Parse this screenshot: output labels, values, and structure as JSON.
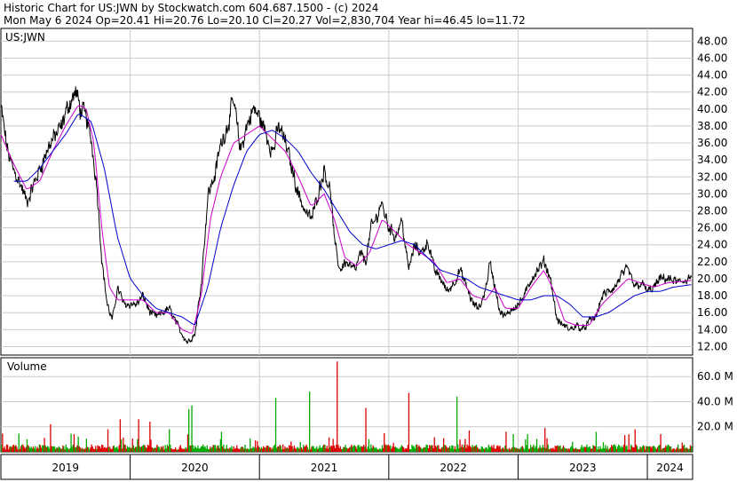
{
  "header": {
    "line1": "Historic Chart for US:JWN by Stockwatch.com 604.687.1500 - (c) 2024",
    "line2": "Mon May  6 2024  Op=20.41  Hi=20.76  Lo=20.10  Cl=20.27  Vol=2,830,704  Year hi=46.45  lo=11.72"
  },
  "chart_data": [
    {
      "type": "line",
      "label": "US:JWN",
      "ylim": [
        11,
        49.5
      ],
      "y_ticks": [
        "48.00",
        "46.00",
        "44.00",
        "42.00",
        "40.00",
        "38.00",
        "36.00",
        "34.00",
        "32.00",
        "30.00",
        "28.00",
        "26.00",
        "24.00",
        "22.00",
        "20.00",
        "18.00",
        "16.00",
        "14.00",
        "12.00"
      ],
      "x_ticks": [
        "2019",
        "2020",
        "2021",
        "2022",
        "2023",
        "2024"
      ],
      "price_anchors": [
        [
          2019.0,
          40.0
        ],
        [
          2019.05,
          35.0
        ],
        [
          2019.09,
          33.0
        ],
        [
          2019.14,
          31.5
        ],
        [
          2019.2,
          29.0
        ],
        [
          2019.25,
          31.0
        ],
        [
          2019.3,
          33.0
        ],
        [
          2019.38,
          36.0
        ],
        [
          2019.47,
          38.0
        ],
        [
          2019.52,
          40.5
        ],
        [
          2019.58,
          42.0
        ],
        [
          2019.61,
          40.0
        ],
        [
          2019.66,
          39.0
        ],
        [
          2019.7,
          36.0
        ],
        [
          2019.74,
          31.0
        ],
        [
          2019.78,
          22.0
        ],
        [
          2019.82,
          17.0
        ],
        [
          2019.86,
          15.0
        ],
        [
          2019.9,
          19.0
        ],
        [
          2019.95,
          17.0
        ],
        [
          2020.05,
          17.0
        ],
        [
          2020.1,
          18.0
        ],
        [
          2020.15,
          16.0
        ],
        [
          2020.2,
          15.5
        ],
        [
          2020.3,
          16.5
        ],
        [
          2020.38,
          14.0
        ],
        [
          2020.44,
          12.5
        ],
        [
          2020.5,
          13.5
        ],
        [
          2020.55,
          20.0
        ],
        [
          2020.6,
          30.0
        ],
        [
          2020.65,
          32.0
        ],
        [
          2020.7,
          36.0
        ],
        [
          2020.75,
          38.0
        ],
        [
          2020.8,
          41.0
        ],
        [
          2020.85,
          35.0
        ],
        [
          2020.9,
          38.0
        ],
        [
          2020.95,
          40.0
        ],
        [
          2021.0,
          39.0
        ],
        [
          2021.05,
          37.0
        ],
        [
          2021.1,
          35.0
        ],
        [
          2021.15,
          38.0
        ],
        [
          2021.2,
          36.0
        ],
        [
          2021.25,
          33.0
        ],
        [
          2021.3,
          30.0
        ],
        [
          2021.35,
          28.0
        ],
        [
          2021.4,
          27.0
        ],
        [
          2021.45,
          30.0
        ],
        [
          2021.5,
          33.0
        ],
        [
          2021.55,
          30.0
        ],
        [
          2021.58,
          24.0
        ],
        [
          2021.62,
          21.0
        ],
        [
          2021.66,
          22.0
        ],
        [
          2021.7,
          21.5
        ],
        [
          2021.74,
          21.0
        ],
        [
          2021.78,
          23.0
        ],
        [
          2021.82,
          22.0
        ],
        [
          2021.86,
          26.0
        ],
        [
          2021.9,
          27.0
        ],
        [
          2021.94,
          29.0
        ],
        [
          2022.0,
          26.0
        ],
        [
          2022.05,
          25.0
        ],
        [
          2022.1,
          27.0
        ],
        [
          2022.15,
          21.0
        ],
        [
          2022.2,
          24.0
        ],
        [
          2022.25,
          23.0
        ],
        [
          2022.3,
          24.5
        ],
        [
          2022.35,
          21.0
        ],
        [
          2022.4,
          20.0
        ],
        [
          2022.45,
          18.5
        ],
        [
          2022.5,
          19.5
        ],
        [
          2022.55,
          21.0
        ],
        [
          2022.6,
          19.0
        ],
        [
          2022.65,
          17.0
        ],
        [
          2022.7,
          16.5
        ],
        [
          2022.75,
          19.0
        ],
        [
          2022.78,
          22.0
        ],
        [
          2022.82,
          19.0
        ],
        [
          2022.86,
          16.0
        ],
        [
          2022.9,
          15.5
        ],
        [
          2022.95,
          16.5
        ],
        [
          2023.0,
          17.0
        ],
        [
          2023.05,
          18.0
        ],
        [
          2023.1,
          20.0
        ],
        [
          2023.15,
          21.0
        ],
        [
          2023.2,
          22.0
        ],
        [
          2023.25,
          20.0
        ],
        [
          2023.3,
          15.0
        ],
        [
          2023.35,
          14.5
        ],
        [
          2023.4,
          14.0
        ],
        [
          2023.45,
          14.5
        ],
        [
          2023.5,
          14.0
        ],
        [
          2023.55,
          15.0
        ],
        [
          2023.6,
          15.5
        ],
        [
          2023.65,
          18.0
        ],
        [
          2023.7,
          18.5
        ],
        [
          2023.75,
          19.0
        ],
        [
          2023.8,
          20.5
        ],
        [
          2023.85,
          21.0
        ],
        [
          2023.9,
          19.0
        ],
        [
          2023.95,
          19.5
        ],
        [
          2024.0,
          18.5
        ],
        [
          2024.05,
          19.0
        ],
        [
          2024.1,
          20.0
        ],
        [
          2024.15,
          20.0
        ],
        [
          2024.25,
          19.5
        ],
        [
          2024.34,
          20.3
        ]
      ],
      "ma_fast_anchors": [
        [
          2019.0,
          37.0
        ],
        [
          2019.1,
          33.5
        ],
        [
          2019.2,
          30.5
        ],
        [
          2019.3,
          31.5
        ],
        [
          2019.4,
          35.0
        ],
        [
          2019.5,
          38.0
        ],
        [
          2019.6,
          40.5
        ],
        [
          2019.66,
          40.0
        ],
        [
          2019.72,
          36.0
        ],
        [
          2019.78,
          26.0
        ],
        [
          2019.84,
          19.0
        ],
        [
          2019.9,
          17.5
        ],
        [
          2020.0,
          17.5
        ],
        [
          2020.1,
          17.5
        ],
        [
          2020.2,
          16.0
        ],
        [
          2020.3,
          16.0
        ],
        [
          2020.4,
          14.0
        ],
        [
          2020.48,
          13.5
        ],
        [
          2020.55,
          18.0
        ],
        [
          2020.62,
          27.0
        ],
        [
          2020.7,
          32.0
        ],
        [
          2020.8,
          36.0
        ],
        [
          2020.9,
          37.0
        ],
        [
          2021.0,
          38.0
        ],
        [
          2021.1,
          36.5
        ],
        [
          2021.2,
          35.0
        ],
        [
          2021.3,
          32.0
        ],
        [
          2021.4,
          28.5
        ],
        [
          2021.5,
          30.0
        ],
        [
          2021.58,
          27.0
        ],
        [
          2021.66,
          22.5
        ],
        [
          2021.75,
          21.5
        ],
        [
          2021.85,
          23.0
        ],
        [
          2021.95,
          27.0
        ],
        [
          2022.05,
          25.5
        ],
        [
          2022.15,
          24.0
        ],
        [
          2022.25,
          23.0
        ],
        [
          2022.35,
          22.0
        ],
        [
          2022.45,
          19.5
        ],
        [
          2022.55,
          20.0
        ],
        [
          2022.65,
          18.0
        ],
        [
          2022.75,
          17.5
        ],
        [
          2022.82,
          19.0
        ],
        [
          2022.9,
          16.5
        ],
        [
          2023.0,
          16.5
        ],
        [
          2023.1,
          19.0
        ],
        [
          2023.2,
          21.0
        ],
        [
          2023.28,
          18.5
        ],
        [
          2023.36,
          15.0
        ],
        [
          2023.45,
          14.5
        ],
        [
          2023.55,
          14.5
        ],
        [
          2023.65,
          17.0
        ],
        [
          2023.75,
          18.5
        ],
        [
          2023.85,
          20.0
        ],
        [
          2023.95,
          19.5
        ],
        [
          2024.05,
          19.0
        ],
        [
          2024.15,
          19.5
        ],
        [
          2024.34,
          19.8
        ]
      ],
      "ma_slow_anchors": [
        [
          2019.1,
          31.5
        ],
        [
          2019.2,
          31.5
        ],
        [
          2019.3,
          33.0
        ],
        [
          2019.4,
          35.0
        ],
        [
          2019.5,
          37.0
        ],
        [
          2019.6,
          39.5
        ],
        [
          2019.7,
          38.5
        ],
        [
          2019.8,
          33.0
        ],
        [
          2019.9,
          25.0
        ],
        [
          2020.0,
          20.0
        ],
        [
          2020.1,
          18.0
        ],
        [
          2020.2,
          16.5
        ],
        [
          2020.3,
          16.0
        ],
        [
          2020.4,
          15.5
        ],
        [
          2020.5,
          14.5
        ],
        [
          2020.6,
          19.0
        ],
        [
          2020.7,
          26.0
        ],
        [
          2020.8,
          31.0
        ],
        [
          2020.9,
          35.0
        ],
        [
          2021.0,
          37.0
        ],
        [
          2021.1,
          37.5
        ],
        [
          2021.2,
          36.5
        ],
        [
          2021.3,
          35.0
        ],
        [
          2021.4,
          32.5
        ],
        [
          2021.5,
          30.5
        ],
        [
          2021.6,
          28.0
        ],
        [
          2021.7,
          25.5
        ],
        [
          2021.8,
          24.0
        ],
        [
          2021.9,
          23.5
        ],
        [
          2022.0,
          24.0
        ],
        [
          2022.1,
          24.5
        ],
        [
          2022.2,
          24.0
        ],
        [
          2022.3,
          22.5
        ],
        [
          2022.4,
          21.0
        ],
        [
          2022.5,
          20.5
        ],
        [
          2022.6,
          20.0
        ],
        [
          2022.7,
          19.0
        ],
        [
          2022.8,
          18.5
        ],
        [
          2022.9,
          18.0
        ],
        [
          2023.0,
          17.5
        ],
        [
          2023.1,
          17.5
        ],
        [
          2023.2,
          18.0
        ],
        [
          2023.3,
          18.0
        ],
        [
          2023.4,
          17.0
        ],
        [
          2023.5,
          15.5
        ],
        [
          2023.6,
          15.5
        ],
        [
          2023.7,
          16.0
        ],
        [
          2023.8,
          17.0
        ],
        [
          2023.9,
          18.0
        ],
        [
          2024.0,
          18.5
        ],
        [
          2024.1,
          18.5
        ],
        [
          2024.2,
          19.0
        ],
        [
          2024.34,
          19.3
        ]
      ],
      "colors": {
        "price": "#000000",
        "ma_fast": "#cc00cc",
        "ma_slow": "#0000cc"
      }
    },
    {
      "type": "bar",
      "label": "Volume",
      "ylim": [
        0,
        75
      ],
      "y_ticks": [
        "60.0 M",
        "40.0 M",
        "20.0 M"
      ],
      "typical_volume_m": 3.5,
      "spikes": [
        [
          2019.2,
          10
        ],
        [
          2019.38,
          22
        ],
        [
          2019.82,
          18
        ],
        [
          2019.92,
          26
        ],
        [
          2020.06,
          26
        ],
        [
          2020.15,
          24
        ],
        [
          2020.3,
          18
        ],
        [
          2020.45,
          34
        ],
        [
          2020.47,
          37
        ],
        [
          2020.7,
          16
        ],
        [
          2021.12,
          43
        ],
        [
          2021.38,
          48
        ],
        [
          2021.6,
          72
        ],
        [
          2021.82,
          35
        ],
        [
          2022.15,
          47
        ],
        [
          2022.52,
          44
        ],
        [
          2022.62,
          17
        ],
        [
          2022.9,
          16
        ],
        [
          2023.05,
          10
        ],
        [
          2023.2,
          19
        ],
        [
          2023.42,
          8
        ],
        [
          2023.6,
          16
        ],
        [
          2023.9,
          18
        ],
        [
          2024.1,
          8
        ]
      ],
      "colors": {
        "up": "#00aa00",
        "down": "#dd0000"
      }
    }
  ]
}
